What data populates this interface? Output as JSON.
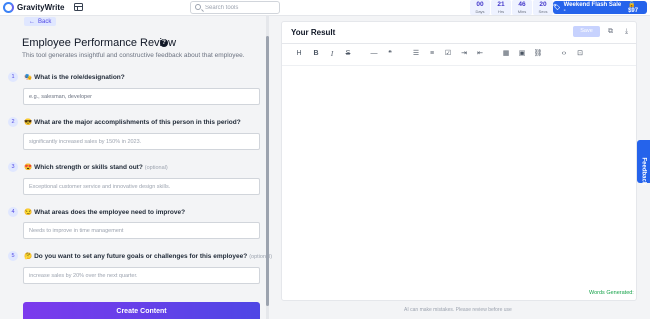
{
  "header": {
    "brand": "GravityWrite",
    "search_placeholder": "Search tools",
    "countdown": [
      {
        "value": "00",
        "unit": "Days"
      },
      {
        "value": "21",
        "unit": "Hrs"
      },
      {
        "value": "46",
        "unit": "Mins"
      },
      {
        "value": "20",
        "unit": "Secs"
      }
    ],
    "flash_sale": {
      "label": "Weekend Flash Sale -",
      "price": "$97"
    }
  },
  "form": {
    "back_label": "Back",
    "title": "Employee Performance Review",
    "description": "This tool generates insightful and constructive feedback about that employee.",
    "questions": [
      {
        "num": "1",
        "emoji": "🎭",
        "label": "What is the role/designation?",
        "optional": "",
        "placeholder": "e.g., salesman, developer"
      },
      {
        "num": "2",
        "emoji": "😎",
        "label": "What are the major accomplishments of this person in this period?",
        "optional": "",
        "placeholder": "significantly increased sales by 150% in 2023."
      },
      {
        "num": "3",
        "emoji": "😍",
        "label": "Which strength or skills stand out?",
        "optional": "(optional)",
        "placeholder": "Exceptional customer service and innovative design skills."
      },
      {
        "num": "4",
        "emoji": "😏",
        "label": "What areas does the employee need to improve?",
        "optional": "",
        "placeholder": "Needs to improve in time management"
      },
      {
        "num": "5",
        "emoji": "🤔",
        "label": "Do you want to set any future goals or challenges for this employee?",
        "optional": "(optional)",
        "placeholder": "increase sales by 20% over the next quarter."
      }
    ],
    "create_label": "Create Content"
  },
  "result": {
    "title": "Your Result",
    "save_label": "Save",
    "words_label": "Words Generated:",
    "disclaimer": "AI can make mistakes. Please review before use"
  },
  "feedback_label": "Feedback",
  "colors": {
    "accent": "#2563eb",
    "brand_purple": "#7c3aed",
    "success": "#16a34a"
  }
}
